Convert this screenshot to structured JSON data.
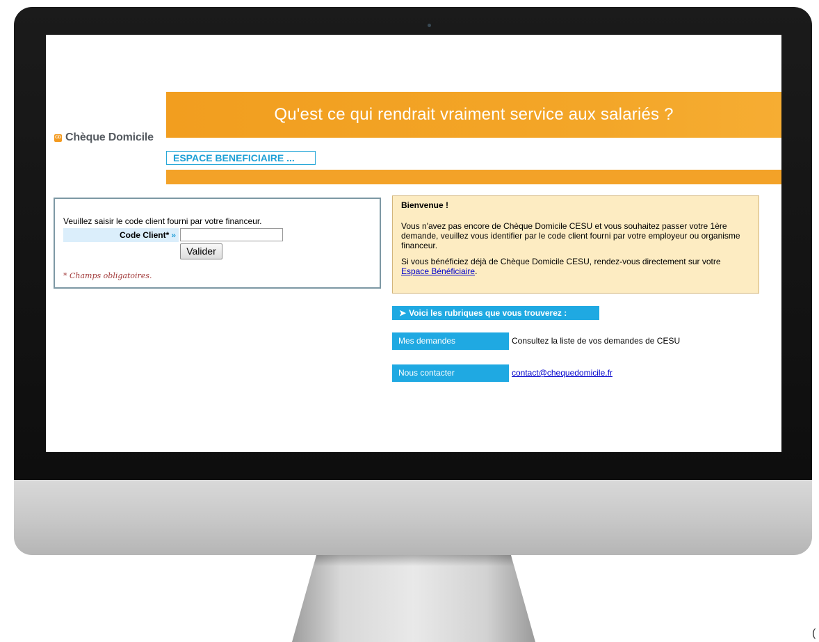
{
  "header": {
    "banner_title": "Qu'est ce qui rendrait vraiment service aux salariés ?",
    "logo_text": "Chèque Domicile",
    "section_tab": "ESPACE BENEFICIAIRE ..."
  },
  "login": {
    "instruction": "Veuillez saisir le code client fourni par votre financeur.",
    "code_label": "Code Client*",
    "code_chevron": "»",
    "code_value": "",
    "submit_label": "Valider",
    "required_note": "* Champs obligatoires."
  },
  "welcome": {
    "title": "Bienvenue !",
    "para1": "Vous n'avez pas encore de Chèque Domicile CESU et vous souhaitez passer votre 1ère demande, veuillez vous identifier par le code client fourni par votre employeur ou organisme financeur.",
    "para2_text": "Si vous bénéficiez déjà de Chèque Domicile CESU, rendez-vous directement sur votre ",
    "para2_link": "Espace Bénéficiaire",
    "para2_end": "."
  },
  "rubriques": {
    "header": "Voici les rubriques que vous trouverez :",
    "header_arrow": "➤",
    "items": [
      {
        "label": "Mes demandes",
        "description": "Consultez la liste de vos demandes de CESU"
      },
      {
        "label": "Nous contacter",
        "description": "contact@chequedomicile.fr"
      }
    ]
  },
  "colors": {
    "orange": "#f3a228",
    "blue": "#1fa9e2",
    "welcome_bg": "#fdecc2"
  }
}
